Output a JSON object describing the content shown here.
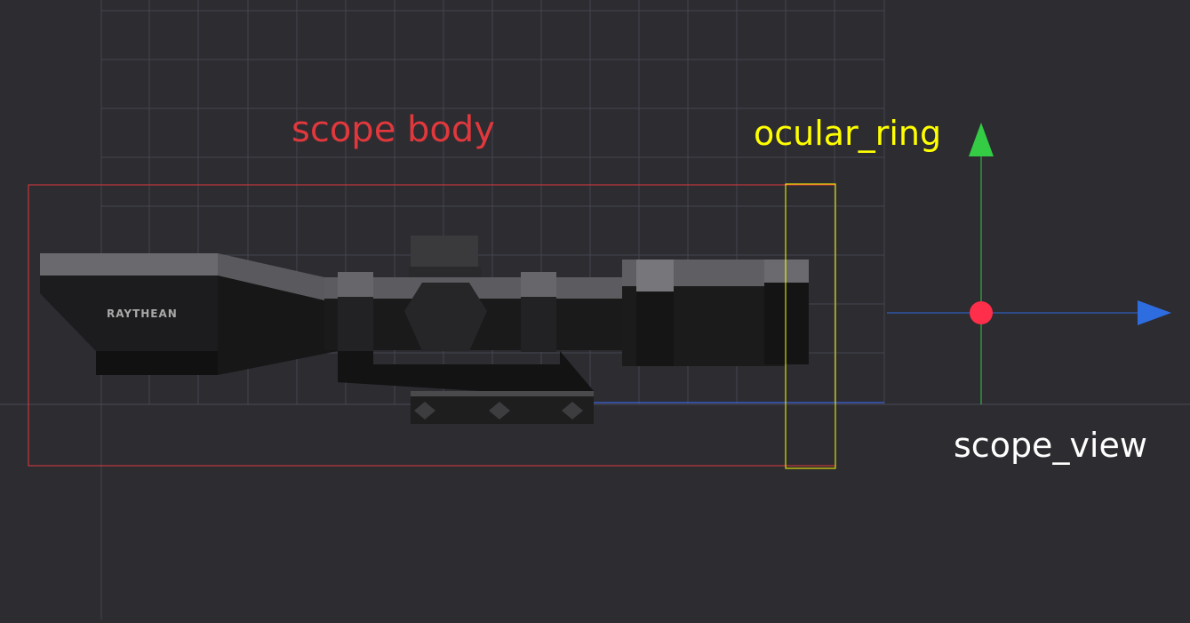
{
  "scene": {
    "background": "#2c2c31",
    "grid_color": "#45454f",
    "ground_line_color": "#3a5bbf"
  },
  "labels": {
    "scope_body": {
      "text": "scope body",
      "color": "#e0383c"
    },
    "ocular_ring": {
      "text": "ocular_ring",
      "color": "#ffff00"
    },
    "scope_view": {
      "text": "scope_view",
      "color": "#ffffff"
    }
  },
  "model": {
    "brand": "RAYTHEAN",
    "brand_color": "#a8a8a8"
  },
  "gizmo": {
    "x_axis_color": "#2e6de0",
    "y_axis_color": "#33cc44",
    "origin_color": "#ff2e4a"
  }
}
